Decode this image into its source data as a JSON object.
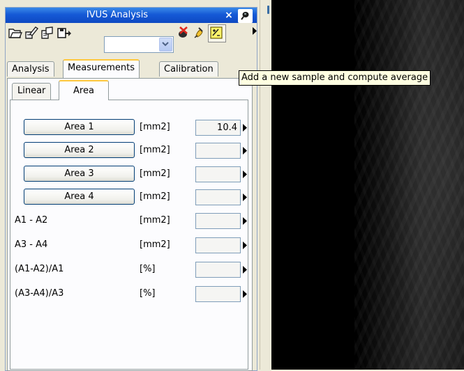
{
  "panel": {
    "title": "IVUS Analysis",
    "close_label": "×"
  },
  "toolbar": {
    "combo_value": "",
    "icons": [
      "open-folder-icon",
      "edit-save-icon",
      "save-icon",
      "export-icon",
      "delete-sample-icon",
      "compute-icon",
      "add-sample-icon",
      "more-chevron-icon"
    ]
  },
  "tabs": [
    {
      "label": "Analysis",
      "active": false
    },
    {
      "label": "Measurements",
      "active": true
    },
    {
      "label": "Calibration",
      "active": false
    }
  ],
  "subtabs": [
    {
      "label": "Linear",
      "active": false
    },
    {
      "label": "Area",
      "active": true
    }
  ],
  "rows": [
    {
      "label": "Area 1",
      "unit": "[mm2]",
      "value": "10.4",
      "button": true
    },
    {
      "label": "Area 2",
      "unit": "[mm2]",
      "value": "",
      "button": true
    },
    {
      "label": "Area 3",
      "unit": "[mm2]",
      "value": "",
      "button": true
    },
    {
      "label": "Area 4",
      "unit": "[mm2]",
      "value": "",
      "button": true
    },
    {
      "label": "A1 - A2",
      "unit": "[mm2]",
      "value": "",
      "button": false
    },
    {
      "label": "A3 - A4",
      "unit": "[mm2]",
      "value": "",
      "button": false
    },
    {
      "label": "(A1-A2)/A1",
      "unit": "[%]",
      "value": "",
      "button": false
    },
    {
      "label": "(A3-A4)/A3",
      "unit": "[%]",
      "value": "",
      "button": false
    }
  ],
  "tooltip": {
    "text": "Add a new sample and compute average"
  },
  "colors": {
    "titlebar": "#0e49c2",
    "tab_highlight": "#ffc83c",
    "tooltip_bg": "#ffffe1",
    "viewer_bg": "#000000"
  }
}
